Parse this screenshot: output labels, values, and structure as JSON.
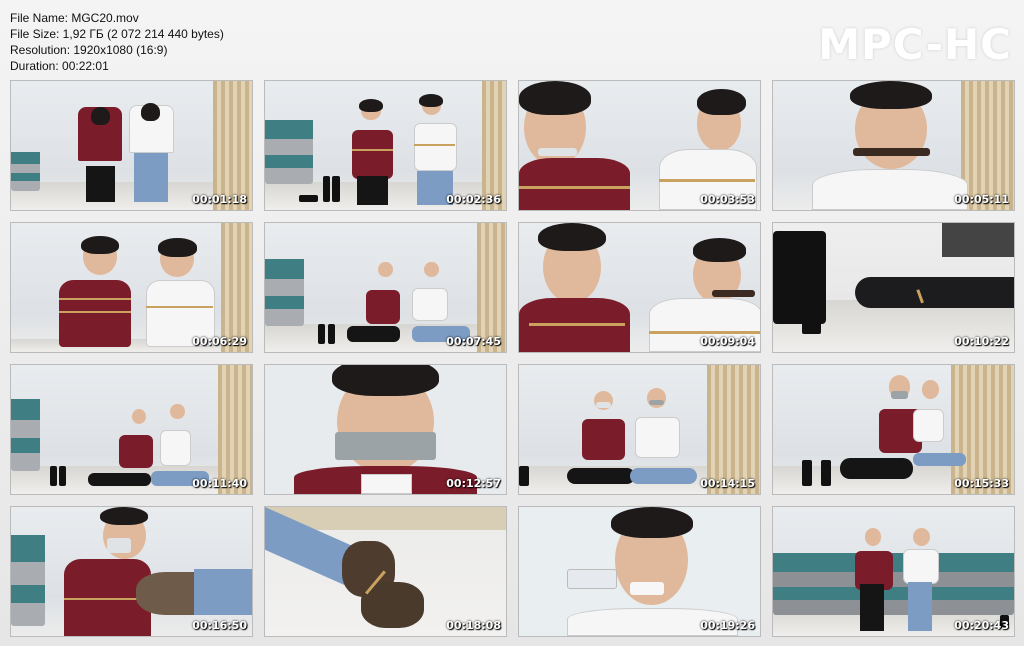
{
  "file_info": {
    "name_line": "File Name: MGC20.mov",
    "size_line": "File Size: 1,92 ГБ (2 072 214 440 bytes)",
    "resolution_line": "Resolution: 1920x1080 (16:9)",
    "duration_line": "Duration: 00:22:01"
  },
  "logo": "MPC-HC",
  "thumbnails": [
    {
      "time": "00:01:18"
    },
    {
      "time": "00:02:36"
    },
    {
      "time": "00:03:53"
    },
    {
      "time": "00:05:11"
    },
    {
      "time": "00:06:29"
    },
    {
      "time": "00:07:45"
    },
    {
      "time": "00:09:04"
    },
    {
      "time": "00:10:22"
    },
    {
      "time": "00:11:40"
    },
    {
      "time": "00:12:57"
    },
    {
      "time": "00:14:15"
    },
    {
      "time": "00:15:33"
    },
    {
      "time": "00:16:50"
    },
    {
      "time": "00:18:08"
    },
    {
      "time": "00:19:26"
    },
    {
      "time": "00:20:43"
    }
  ]
}
